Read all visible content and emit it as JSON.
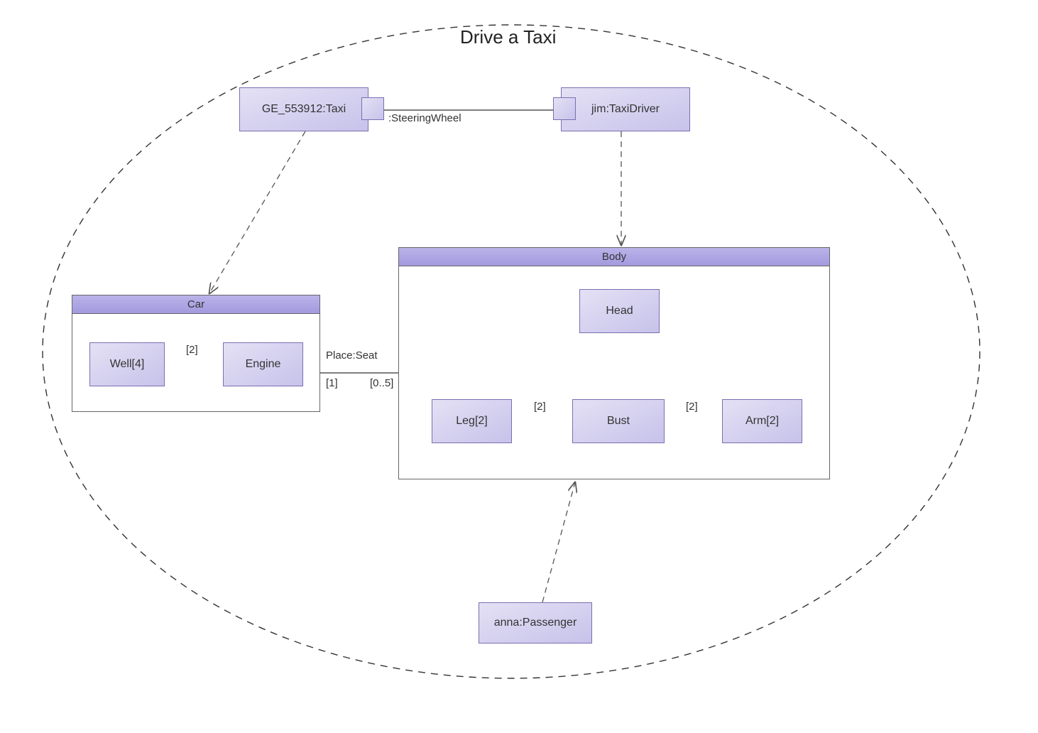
{
  "title": "Drive a Taxi",
  "nodes": {
    "taxi": "GE_553912:Taxi",
    "driver": "jim:TaxiDriver",
    "passenger": "anna:Passenger",
    "car_frame": "Car",
    "well": "Well[4]",
    "engine": "Engine",
    "body_frame": "Body",
    "head": "Head",
    "leg": "Leg[2]",
    "bust": "Bust",
    "arm": "Arm[2]"
  },
  "labels": {
    "steering": ":SteeringWheel",
    "place_seat": "Place:Seat",
    "well_engine": "[2]",
    "car_mult": "[1]",
    "body_mult": "[0..5]",
    "leg_bust": "[2]",
    "bust_arm": "[2]"
  }
}
